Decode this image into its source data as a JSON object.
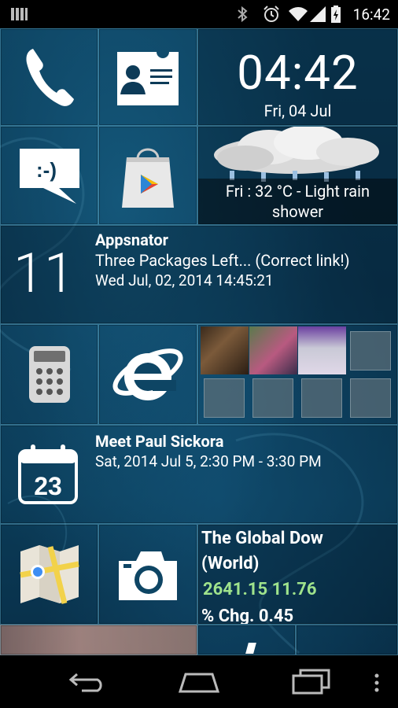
{
  "status_bar": {
    "time": "16:42",
    "icons": [
      "notification-bars-icon",
      "bluetooth-icon",
      "alarm-icon",
      "wifi-icon",
      "signal-icon",
      "battery-charging-icon"
    ]
  },
  "clock_tile": {
    "time": "04:42",
    "date": "Fri, 04 Jul"
  },
  "weather_tile": {
    "text_line1": "Fri : 32 °C - Light rain",
    "text_line2": "shower"
  },
  "email_tile": {
    "count": "11",
    "sender": "Appsnator",
    "subject": "Three Packages Left... (Correct link!)",
    "date": "Wed Jul, 02, 2014 14:45:21"
  },
  "calendar_tile": {
    "icon_day": "23",
    "event_title": "Meet Paul Sickora",
    "event_time": "Sat, 2014 Jul 5, 2:30 PM - 3:30 PM"
  },
  "stock_tile": {
    "name_line1": "The Global Dow",
    "name_line2": "(World)",
    "value": "2641.15 11.76",
    "change": "% Chg. 0.45"
  },
  "colors": {
    "accent": "#1a6c94",
    "stock_up": "#9fe38c",
    "tile_border": "#78c8e6"
  }
}
